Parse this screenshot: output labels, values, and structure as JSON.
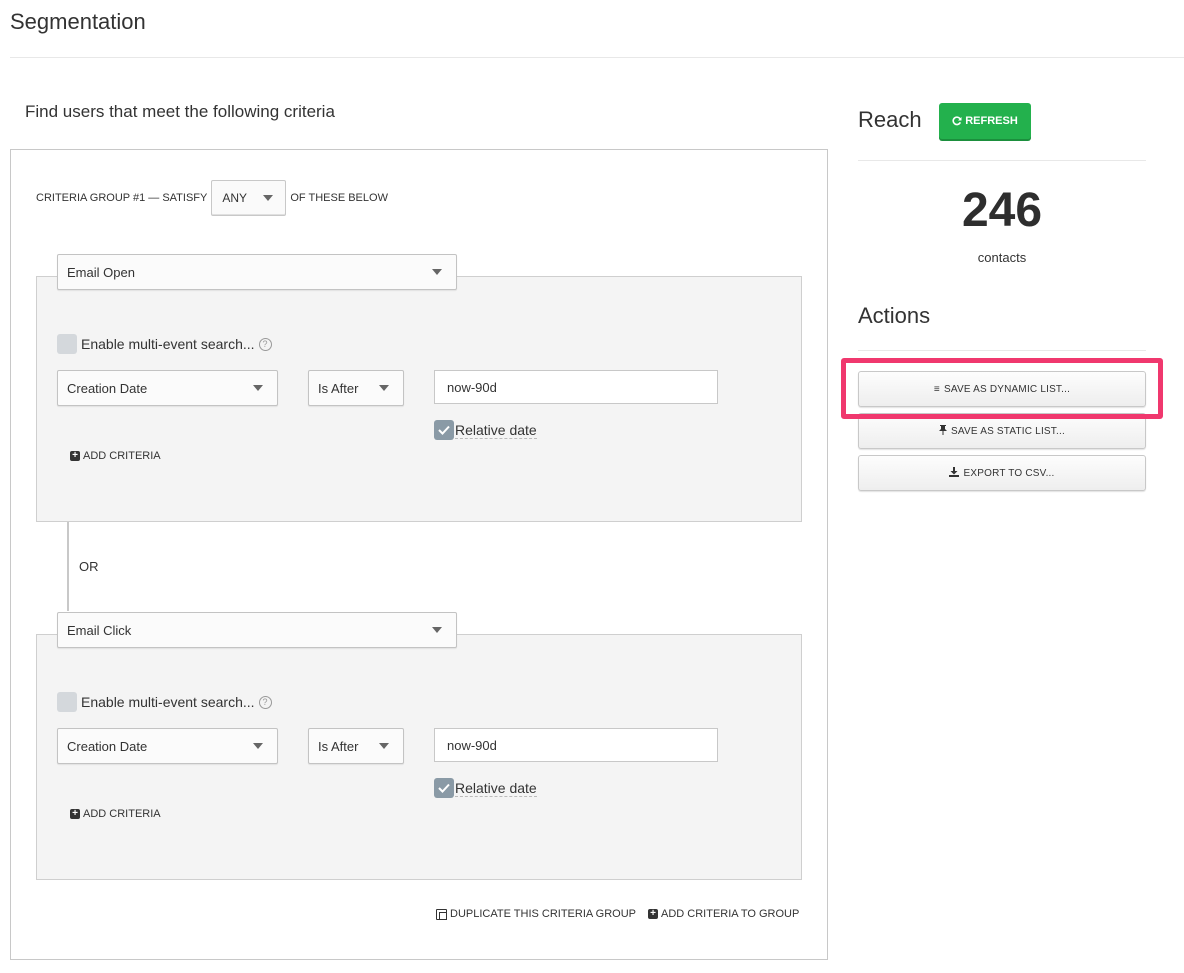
{
  "header": {
    "title": "Segmentation"
  },
  "criteria": {
    "heading": "Find users that meet the following criteria",
    "group": {
      "prefix": "CRITERIA GROUP #1 — SATISFY",
      "match_mode": "ANY",
      "suffix": "OF THESE BELOW",
      "events": [
        {
          "event_type": "Email Open",
          "multi_event_label": "Enable multi-event search...",
          "field": "Creation Date",
          "operator": "Is After",
          "value": "now-90d",
          "relative_label": "Relative date",
          "relative_checked": true,
          "add_criteria_label": "ADD CRITERIA"
        },
        {
          "event_type": "Email Click",
          "multi_event_label": "Enable multi-event search...",
          "field": "Creation Date",
          "operator": "Is After",
          "value": "now-90d",
          "relative_label": "Relative date",
          "relative_checked": true,
          "add_criteria_label": "ADD CRITERIA"
        }
      ],
      "connector_label": "OR",
      "duplicate_label": "DUPLICATE THIS CRITERIA GROUP",
      "add_to_group_label": "ADD CRITERIA TO GROUP"
    }
  },
  "reach": {
    "title": "Reach",
    "refresh_label": "REFRESH",
    "count": "246",
    "unit": "contacts"
  },
  "actions": {
    "title": "Actions",
    "save_dynamic_label": "SAVE AS DYNAMIC LIST...",
    "save_static_label": "SAVE AS STATIC LIST...",
    "export_csv_label": "EXPORT TO CSV..."
  },
  "colors": {
    "refresh_green": "#23b14d",
    "highlight_pink": "#f0386e",
    "checkbox_checked": "#8a9aa6",
    "event_box_bg": "#f4f4f4"
  }
}
